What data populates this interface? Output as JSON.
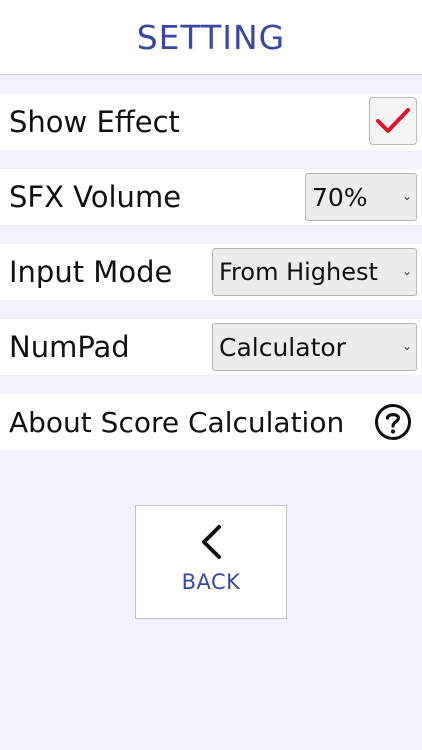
{
  "header": {
    "title": "SETTING"
  },
  "settings": {
    "show_effect": {
      "label": "Show Effect",
      "checked": true,
      "check_color": "#e0142a"
    },
    "sfx_volume": {
      "label": "SFX Volume",
      "value": "70%"
    },
    "input_mode": {
      "label": "Input Mode",
      "value": "From Highest"
    },
    "numpad": {
      "label": "NumPad",
      "value": "Calculator"
    },
    "about": {
      "label": "About Score Calculation",
      "icon": "help-circle-icon"
    }
  },
  "back_button": {
    "label": "BACK",
    "icon": "chevron-left-icon"
  },
  "colors": {
    "accent": "#3a47a8",
    "background": "#f2f1fd",
    "check": "#e0142a"
  }
}
